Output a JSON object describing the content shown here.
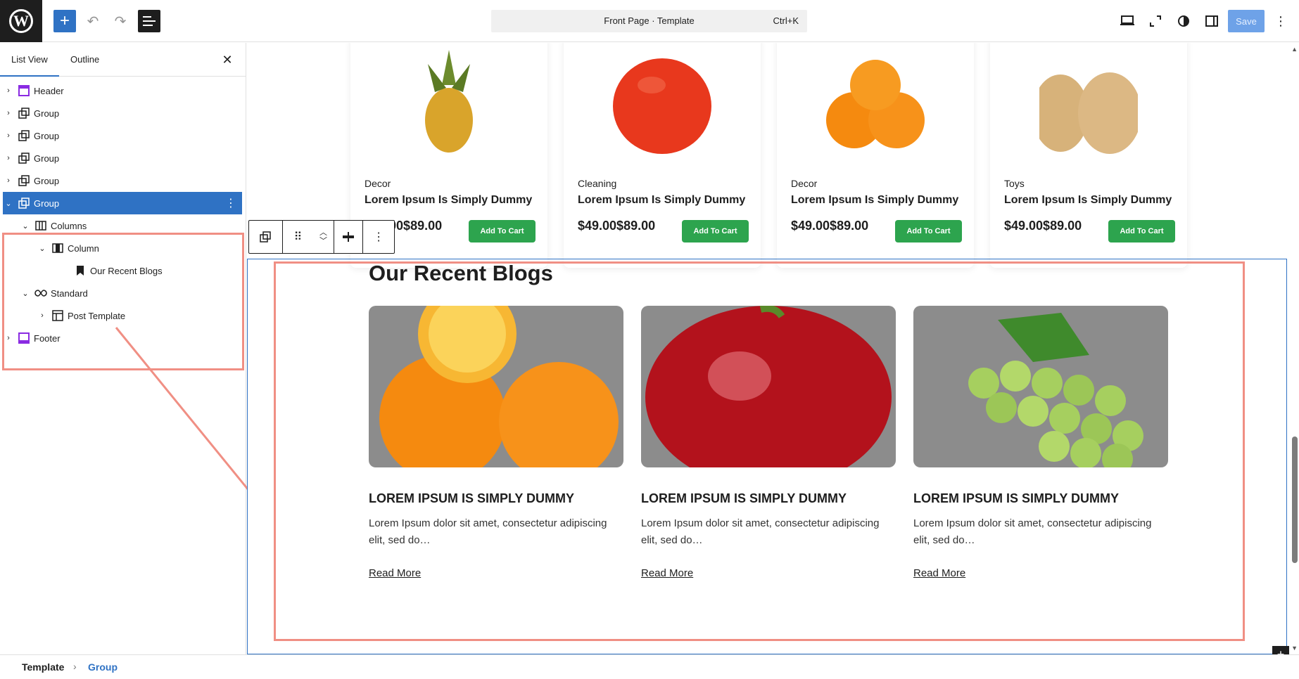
{
  "topbar": {
    "command_title": "Front Page · Template",
    "command_shortcut": "Ctrl+K",
    "save_label": "Save"
  },
  "sidebar": {
    "tabs": [
      "List View",
      "Outline"
    ],
    "items": [
      {
        "label": "Header",
        "icon": "header-icon"
      },
      {
        "label": "Group",
        "icon": "group-icon"
      },
      {
        "label": "Group",
        "icon": "group-icon"
      },
      {
        "label": "Group",
        "icon": "group-icon"
      },
      {
        "label": "Group",
        "icon": "group-icon"
      },
      {
        "label": "Group",
        "icon": "group-icon",
        "selected": true
      },
      {
        "label": "Columns",
        "icon": "columns-icon"
      },
      {
        "label": "Column",
        "icon": "column-icon"
      },
      {
        "label": "Our Recent Blogs",
        "icon": "heading-bookmark-icon"
      },
      {
        "label": "Standard",
        "icon": "query-loop-icon"
      },
      {
        "label": "Post Template",
        "icon": "layout-icon"
      },
      {
        "label": "Footer",
        "icon": "footer-icon"
      }
    ]
  },
  "products": [
    {
      "category": "Decor",
      "title": "Lorem Ipsum Is Simply Dummy",
      "price": "$49.00$89.00",
      "cart": "Add To Cart",
      "image": "pineapple"
    },
    {
      "category": "Cleaning",
      "title": "Lorem Ipsum Is Simply Dummy",
      "price": "$49.00$89.00",
      "cart": "Add To Cart",
      "image": "tomato"
    },
    {
      "category": "Decor",
      "title": "Lorem Ipsum Is Simply Dummy",
      "price": "$49.00$89.00",
      "cart": "Add To Cart",
      "image": "oranges"
    },
    {
      "category": "Toys",
      "title": "Lorem Ipsum Is Simply Dummy",
      "price": "$49.00$89.00",
      "cart": "Add To Cart",
      "image": "potatoes"
    }
  ],
  "blogs": {
    "heading": "Our Recent Blogs",
    "posts": [
      {
        "title": "LOREM IPSUM IS SIMPLY DUMMY",
        "excerpt": "Lorem Ipsum dolor sit amet, consectetur adipiscing elit, sed do…",
        "link": "Read More",
        "image": "oranges"
      },
      {
        "title": "LOREM IPSUM IS SIMPLY DUMMY",
        "excerpt": "Lorem Ipsum dolor sit amet, consectetur adipiscing elit, sed do…",
        "link": "Read More",
        "image": "apple"
      },
      {
        "title": "LOREM IPSUM IS SIMPLY DUMMY",
        "excerpt": "Lorem Ipsum dolor sit amet, consectetur adipiscing elit, sed do…",
        "link": "Read More",
        "image": "grapes"
      }
    ]
  },
  "breadcrumb": {
    "root": "Template",
    "current": "Group"
  },
  "colors": {
    "accent": "#2f72c4",
    "annotation": "#f08f84",
    "cart_button": "#2da44e"
  }
}
